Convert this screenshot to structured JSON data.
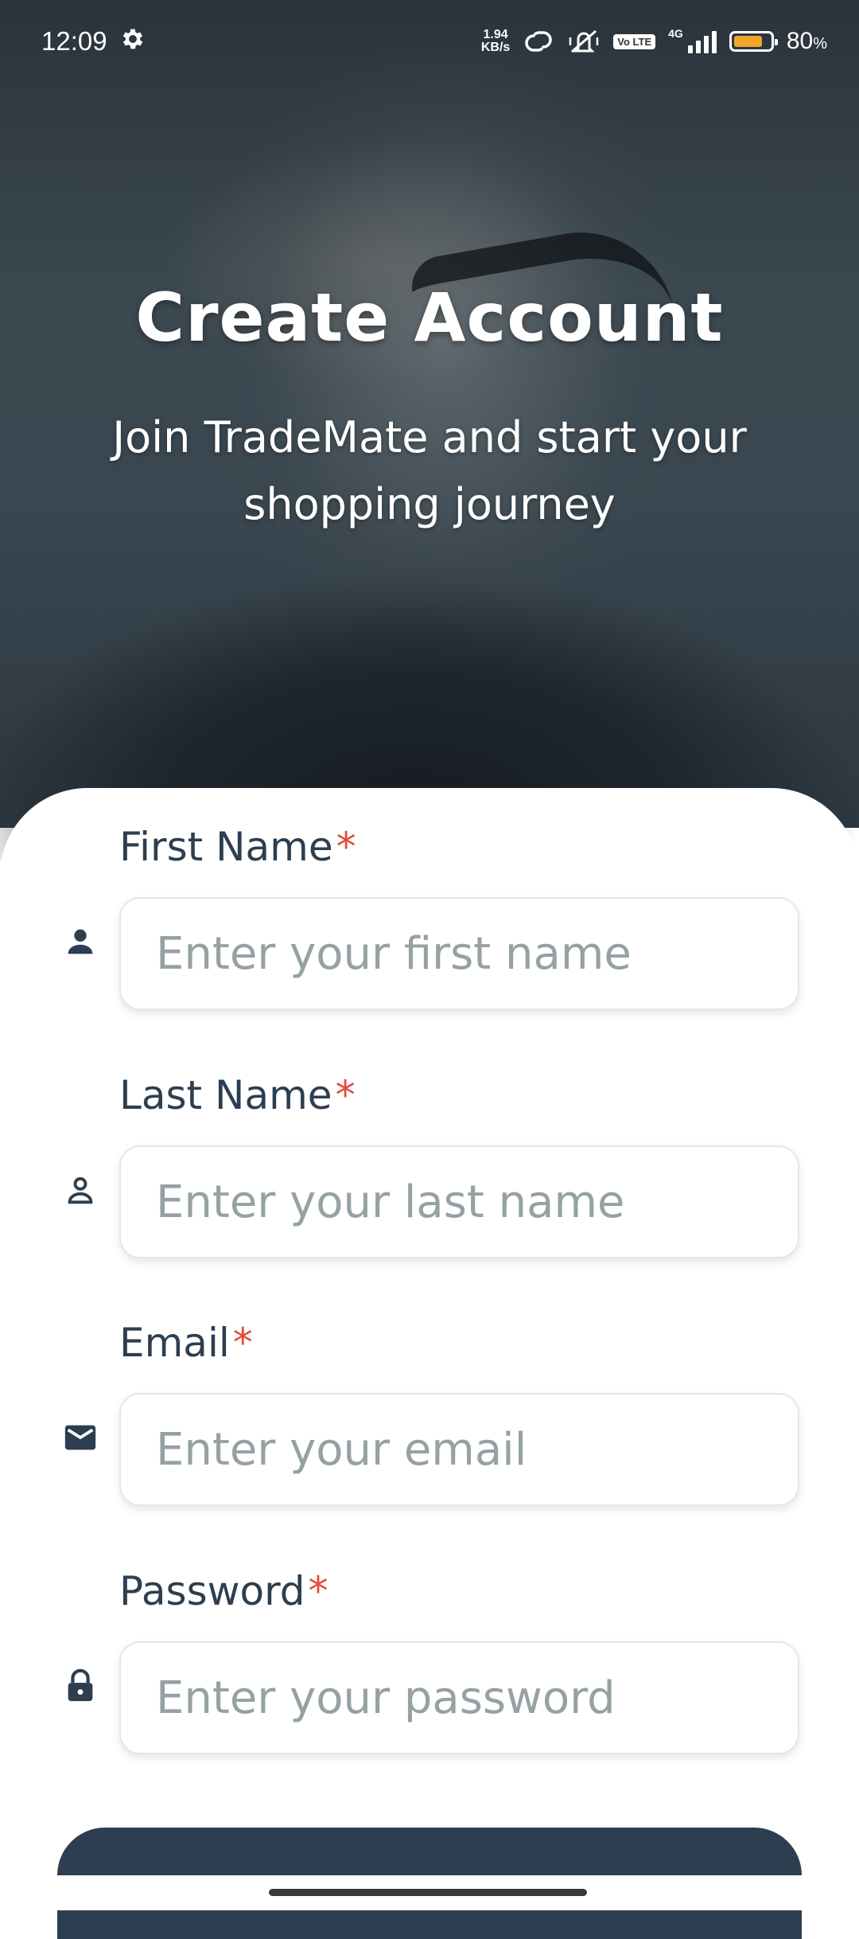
{
  "status_bar": {
    "time": "12:09",
    "speed_value": "1.94",
    "speed_unit": "KB/s",
    "network": "4G",
    "volte": "Vo LTE",
    "battery_percent": "80",
    "battery_unit": "%",
    "battery_level": 0.8,
    "battery_color": "#f0a52b"
  },
  "hero": {
    "title": "Create Account",
    "subtitle": "Join TradeMate and start your shopping journey"
  },
  "form": {
    "required_marker": "*",
    "fields": [
      {
        "label": "First Name",
        "placeholder": "Enter your first name",
        "icon": "person-icon"
      },
      {
        "label": "Last Name",
        "placeholder": "Enter your last name",
        "icon": "person-outline-icon"
      },
      {
        "label": "Email",
        "placeholder": "Enter your email",
        "icon": "mail-icon"
      },
      {
        "label": "Password",
        "placeholder": "Enter your password",
        "icon": "lock-icon"
      }
    ]
  },
  "colors": {
    "primary": "#2c3e50",
    "required": "#e14b3b",
    "placeholder": "#95a1a3"
  }
}
